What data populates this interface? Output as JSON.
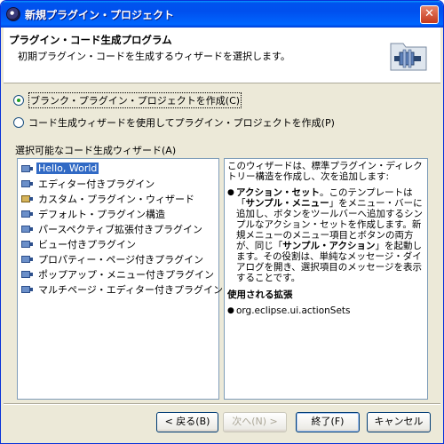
{
  "window": {
    "title": "新規プラグイン・プロジェクト",
    "close_glyph": "✕"
  },
  "header": {
    "title": "プラグイン・コード生成プログラム",
    "description": "初期プラグイン・コードを生成するウィザードを選択します。",
    "icon": "plugin-folder-icon"
  },
  "options": [
    {
      "label": "ブランク・プラグイン・プロジェクトを作成(C)",
      "checked": true
    },
    {
      "label": "コード生成ウィザードを使用してプラグイン・プロジェクトを作成(P)",
      "checked": false
    }
  ],
  "wizard_list": {
    "label": "選択可能なコード生成ウィザード(A)",
    "items": [
      "Hello, World",
      "エディター付きプラグイン",
      "カスタム・プラグイン・ウィザード",
      "デフォルト・プラグイン構造",
      "パースペクティブ拡張付きプラグイン",
      "ビュー付きプラグイン",
      "プロパティー・ページ付きプラグイン",
      "ポップアップ・メニュー付きプラグイン",
      "マルチページ・エディター付きプラグイン"
    ],
    "selected": "Hello, World"
  },
  "description_panel": {
    "intro": "このウィザードは、標準プラグイン・ディレクトリー構造を作成し、次を追加します:",
    "bullet_title": "アクション・セット",
    "bullet_text_1": "。このテンプレートは「",
    "bullet_bold_1": "サンプル・メニュー",
    "bullet_text_2": "」をメニュー・バーに追加し、ボタンをツールバーへ追加するシンプルなアクション・セットを作成します。新規メニューのメニュー項目とボタンの両方が、同じ「",
    "bullet_bold_2": "サンプル・アクション",
    "bullet_text_3": "」を起動します。その役割は、単純なメッセージ・ダイアログを開き、選択項目のメッセージを表示することです。",
    "extensions_heading": "使用される拡張",
    "extension": "org.eclipse.ui.actionSets"
  },
  "buttons": {
    "back": "< 戻る(B)",
    "next": "次へ(N) >",
    "finish": "終了(F)",
    "cancel": "キャンセル"
  }
}
